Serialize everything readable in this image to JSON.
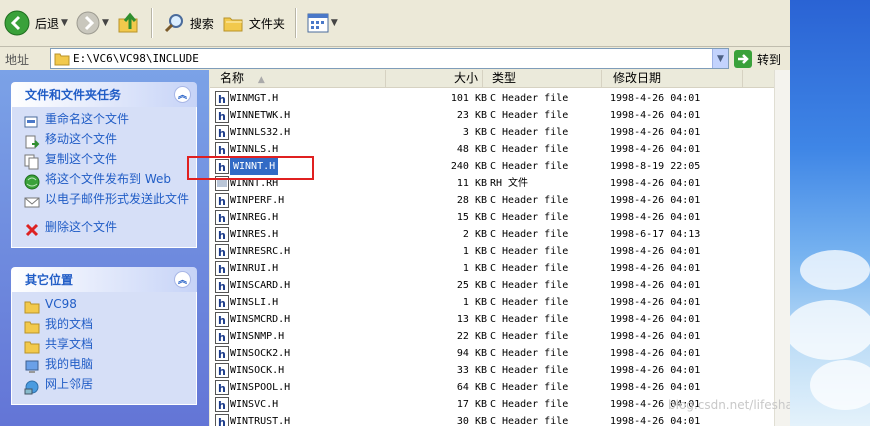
{
  "toolbar": {
    "back_label": "后退",
    "search_label": "搜索",
    "folders_label": "文件夹"
  },
  "address": {
    "label": "地址",
    "path": "E:\\VC6\\VC98\\INCLUDE",
    "go_label": "转到"
  },
  "tasks_panel": {
    "title": "文件和文件夹任务",
    "items": [
      {
        "label": "重命名这个文件",
        "icon": "rename-icon"
      },
      {
        "label": "移动这个文件",
        "icon": "move-icon"
      },
      {
        "label": "复制这个文件",
        "icon": "copy-icon"
      },
      {
        "label": "将这个文件发布到 Web",
        "icon": "publish-web-icon"
      },
      {
        "label": "以电子邮件形式发送此文件",
        "icon": "email-icon"
      },
      {
        "label": "删除这个文件",
        "icon": "delete-icon"
      }
    ]
  },
  "places_panel": {
    "title": "其它位置",
    "items": [
      {
        "label": "VC98",
        "icon": "folder-icon"
      },
      {
        "label": "我的文档",
        "icon": "folder-icon"
      },
      {
        "label": "共享文档",
        "icon": "folder-icon"
      },
      {
        "label": "我的电脑",
        "icon": "computer-icon"
      },
      {
        "label": "网上邻居",
        "icon": "network-icon"
      }
    ]
  },
  "columns": {
    "name": "名称",
    "size": "大小",
    "type": "类型",
    "date": "修改日期"
  },
  "files": [
    {
      "name": "WINMGT.H",
      "size": "101 KB",
      "type": "C Header file",
      "date": "1998-4-26 04:01"
    },
    {
      "name": "WINNETWK.H",
      "size": "23 KB",
      "type": "C Header file",
      "date": "1998-4-26 04:01"
    },
    {
      "name": "WINNLS32.H",
      "size": "3 KB",
      "type": "C Header file",
      "date": "1998-4-26 04:01"
    },
    {
      "name": "WINNLS.H",
      "size": "48 KB",
      "type": "C Header file",
      "date": "1998-4-26 04:01"
    },
    {
      "name": "WINNT.H",
      "size": "240 KB",
      "type": "C Header file",
      "date": "1998-8-19 22:05",
      "selected": true
    },
    {
      "name": "WINNT.RH",
      "size": "11 KB",
      "type": "RH 文件",
      "date": "1998-4-26 04:01"
    },
    {
      "name": "WINPERF.H",
      "size": "28 KB",
      "type": "C Header file",
      "date": "1998-4-26 04:01"
    },
    {
      "name": "WINREG.H",
      "size": "15 KB",
      "type": "C Header file",
      "date": "1998-4-26 04:01"
    },
    {
      "name": "WINRES.H",
      "size": "2 KB",
      "type": "C Header file",
      "date": "1998-6-17 04:13"
    },
    {
      "name": "WINRESRC.H",
      "size": "1 KB",
      "type": "C Header file",
      "date": "1998-4-26 04:01"
    },
    {
      "name": "WINRUI.H",
      "size": "1 KB",
      "type": "C Header file",
      "date": "1998-4-26 04:01"
    },
    {
      "name": "WINSCARD.H",
      "size": "25 KB",
      "type": "C Header file",
      "date": "1998-4-26 04:01"
    },
    {
      "name": "WINSLI.H",
      "size": "1 KB",
      "type": "C Header file",
      "date": "1998-4-26 04:01"
    },
    {
      "name": "WINSMCRD.H",
      "size": "13 KB",
      "type": "C Header file",
      "date": "1998-4-26 04:01"
    },
    {
      "name": "WINSNMP.H",
      "size": "22 KB",
      "type": "C Header file",
      "date": "1998-4-26 04:01"
    },
    {
      "name": "WINSOCK2.H",
      "size": "94 KB",
      "type": "C Header file",
      "date": "1998-4-26 04:01"
    },
    {
      "name": "WINSOCK.H",
      "size": "33 KB",
      "type": "C Header file",
      "date": "1998-4-26 04:01"
    },
    {
      "name": "WINSPOOL.H",
      "size": "64 KB",
      "type": "C Header file",
      "date": "1998-4-26 04:01"
    },
    {
      "name": "WINSVC.H",
      "size": "17 KB",
      "type": "C Header file",
      "date": "1998-4-26 04:01"
    },
    {
      "name": "WINTRUST.H",
      "size": "30 KB",
      "type": "C Header file",
      "date": "1998-4-26 04:01"
    }
  ],
  "watermark": "blog.csdn.net/lifeshave"
}
